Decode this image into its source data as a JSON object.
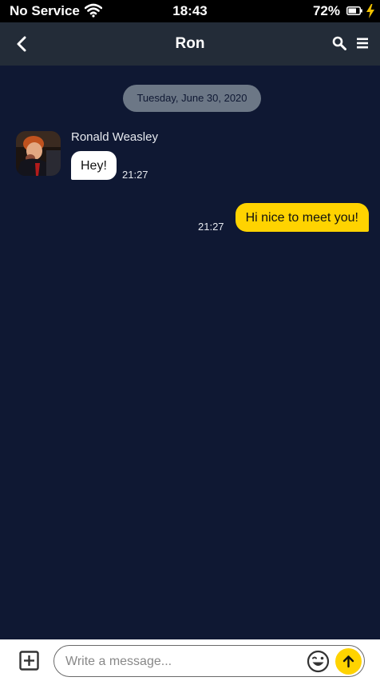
{
  "status_bar": {
    "carrier": "No Service",
    "time": "18:43",
    "battery_percent": "72%",
    "icons": [
      "wifi-icon",
      "battery-icon",
      "charging-bolt-icon"
    ]
  },
  "header": {
    "title": "Ron",
    "icons": [
      "back-chevron-icon",
      "search-icon",
      "menu-icon"
    ]
  },
  "conversation": {
    "date_label": "Tuesday, June 30, 2020",
    "messages": [
      {
        "direction": "incoming",
        "sender": "Ronald Weasley",
        "text": "Hey!",
        "time": "21:27"
      },
      {
        "direction": "outgoing",
        "text": "Hi nice to meet you!",
        "time": "21:27"
      }
    ]
  },
  "composer": {
    "placeholder": "Write a message...",
    "value": "",
    "icons": [
      "add-icon",
      "emoji-icon",
      "send-arrow-icon"
    ]
  },
  "colors": {
    "background": "#0f1833",
    "header": "#232c38",
    "accent": "#ffd300",
    "date_pill": "#6c7786"
  }
}
